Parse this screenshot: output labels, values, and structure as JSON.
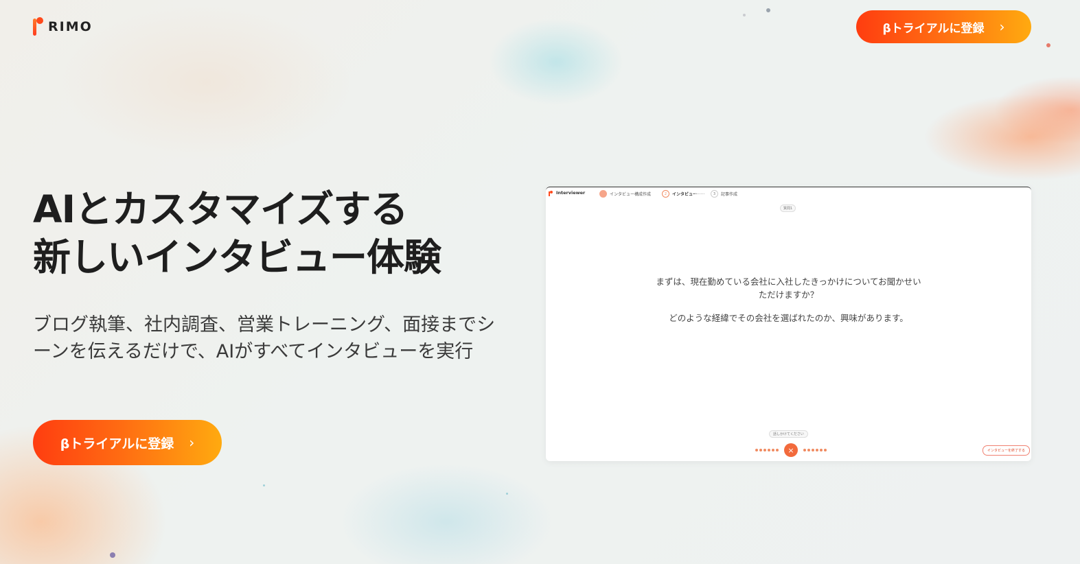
{
  "brand": {
    "name": "RIMO"
  },
  "header": {
    "cta_label": "βトライアルに登録",
    "cta_chevron": "›"
  },
  "hero": {
    "title_line1": "AIとカスタマイズする",
    "title_line2": "新しいインタビュー体験",
    "subtitle": "ブログ執筆、社内調査、営業トレーニング、面接までシーンを伝えるだけで、AIがすべてインタビューを実行",
    "cta_label": "βトライアルに登録",
    "cta_chevron": "›"
  },
  "preview": {
    "app_name": "Interviewer",
    "steps": [
      {
        "number": "1",
        "label": "インタビュー構成作成",
        "state": "done"
      },
      {
        "number": "2",
        "label": "インタビュー",
        "state": "active"
      },
      {
        "number": "3",
        "label": "記事作成",
        "state": "pending"
      }
    ],
    "badge": "質問1",
    "question_line1": "まずは、現在勤めている会社に入社したきっかけについてお聞かせいただけますか？",
    "question_line2": "どのような経緯でその会社を選ばれたのか、興味があります。",
    "hint": "話しかけてください",
    "stop_icon": "×",
    "end_button": "インタビューを終了する"
  },
  "colors": {
    "accent_start": "#ff3d10",
    "accent_end": "#ffaa10",
    "brand_red": "#ff4a1c"
  },
  "icons": [
    "rimo-logo-mark",
    "chevron-right-icon",
    "close-icon",
    "audio-wave-icon"
  ]
}
